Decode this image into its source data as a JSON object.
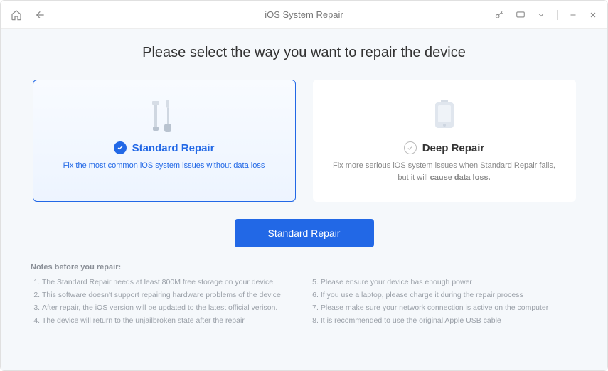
{
  "titlebar": {
    "title": "iOS System Repair"
  },
  "page_title": "Please select the way you want to repair the device",
  "cards": {
    "standard": {
      "title": "Standard Repair",
      "desc": "Fix the most common iOS system issues without data loss"
    },
    "deep": {
      "title": "Deep Repair",
      "desc_pre": "Fix more serious iOS system issues when Standard Repair fails, but it will ",
      "desc_strong": "cause data loss."
    }
  },
  "primary_button": "Standard Repair",
  "notes": {
    "title": "Notes before you repair:",
    "left": [
      "The Standard Repair needs at least 800M free storage on your device",
      "This software doesn't support repairing hardware problems of the device",
      "After repair, the iOS version will be updated to the latest official verison.",
      "The device will return to the unjailbroken state after the repair"
    ],
    "right": [
      "Please ensure your device has enough power",
      "If you use a laptop, please charge it during the repair process",
      "Please make sure your network connection is active on the computer",
      "It is recommended to use the original Apple USB cable"
    ]
  }
}
